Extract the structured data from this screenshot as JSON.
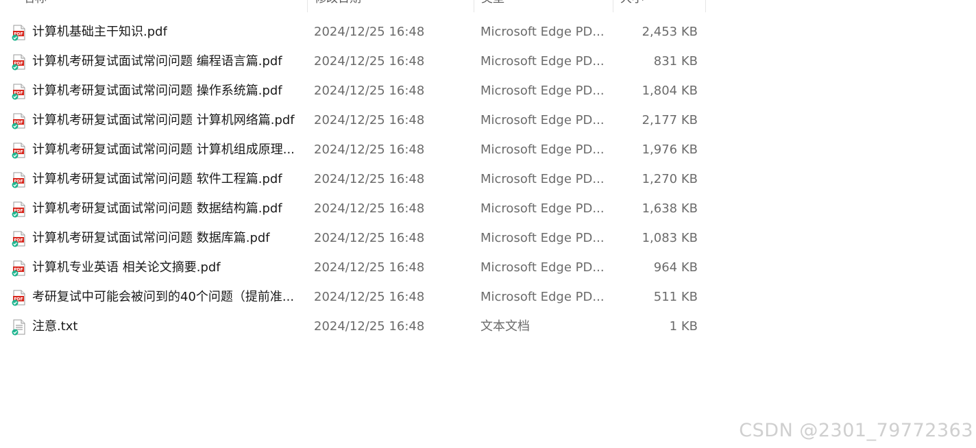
{
  "columns": {
    "name": "名称",
    "date": "修改日期",
    "type": "类型",
    "size": "大小"
  },
  "files": [
    {
      "name": "计算机基础主干知识.pdf",
      "date": "2024/12/25 16:48",
      "type": "Microsoft Edge PD...",
      "size": "2,453 KB",
      "icon": "pdf-file-icon"
    },
    {
      "name": "计算机考研复试面试常问问题 编程语言篇.pdf",
      "date": "2024/12/25 16:48",
      "type": "Microsoft Edge PD...",
      "size": "831 KB",
      "icon": "pdf-file-icon"
    },
    {
      "name": "计算机考研复试面试常问问题 操作系统篇.pdf",
      "date": "2024/12/25 16:48",
      "type": "Microsoft Edge PD...",
      "size": "1,804 KB",
      "icon": "pdf-file-icon"
    },
    {
      "name": "计算机考研复试面试常问问题 计算机网络篇.pdf",
      "date": "2024/12/25 16:48",
      "type": "Microsoft Edge PD...",
      "size": "2,177 KB",
      "icon": "pdf-file-icon"
    },
    {
      "name": "计算机考研复试面试常问问题 计算机组成原理...",
      "date": "2024/12/25 16:48",
      "type": "Microsoft Edge PD...",
      "size": "1,976 KB",
      "icon": "pdf-file-icon"
    },
    {
      "name": "计算机考研复试面试常问问题 软件工程篇.pdf",
      "date": "2024/12/25 16:48",
      "type": "Microsoft Edge PD...",
      "size": "1,270 KB",
      "icon": "pdf-file-icon"
    },
    {
      "name": "计算机考研复试面试常问问题 数据结构篇.pdf",
      "date": "2024/12/25 16:48",
      "type": "Microsoft Edge PD...",
      "size": "1,638 KB",
      "icon": "pdf-file-icon"
    },
    {
      "name": "计算机考研复试面试常问问题 数据库篇.pdf",
      "date": "2024/12/25 16:48",
      "type": "Microsoft Edge PD...",
      "size": "1,083 KB",
      "icon": "pdf-file-icon"
    },
    {
      "name": "计算机专业英语 相关论文摘要.pdf",
      "date": "2024/12/25 16:48",
      "type": "Microsoft Edge PD...",
      "size": "964 KB",
      "icon": "pdf-file-icon"
    },
    {
      "name": "考研复试中可能会被问到的40个问题（提前准...",
      "date": "2024/12/25 16:48",
      "type": "Microsoft Edge PD...",
      "size": "511 KB",
      "icon": "pdf-file-icon"
    },
    {
      "name": "注意.txt",
      "date": "2024/12/25 16:48",
      "type": "文本文档",
      "size": "1 KB",
      "icon": "text-file-icon"
    }
  ],
  "watermark": "CSDN @2301_79772363",
  "colors": {
    "pdf_icon": "#d9261c",
    "sync_check": "#1fb58f",
    "text_primary": "#1a1a1a",
    "text_secondary": "#6b6b6b"
  }
}
